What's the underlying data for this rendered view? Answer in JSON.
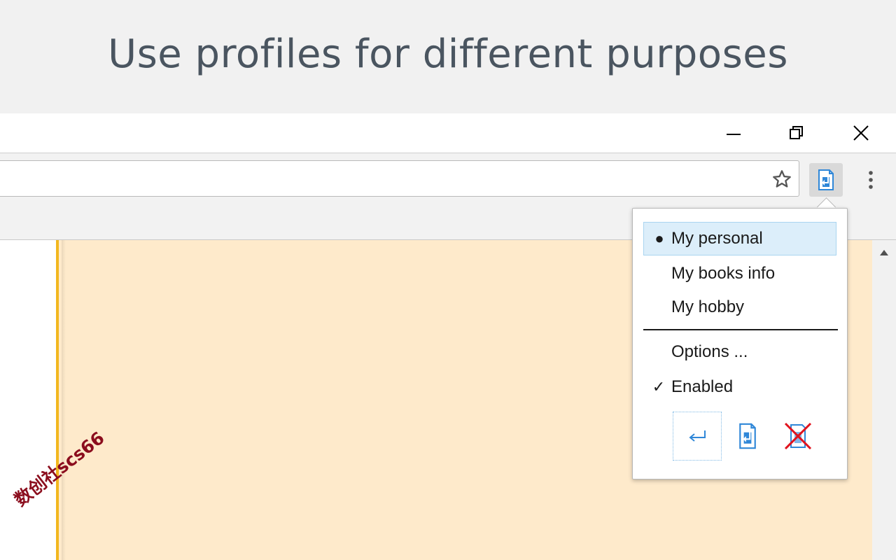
{
  "headline": "Use profiles for different purposes",
  "window": {
    "minimize_icon": "minimize-icon",
    "maximize_icon": "restore-icon",
    "close_icon": "close-icon"
  },
  "toolbar": {
    "bookmark_icon": "star-icon",
    "extension_icon": "profile-switch-icon",
    "menu_icon": "kebab-menu-icon"
  },
  "popup": {
    "profiles": [
      {
        "label": "My personal",
        "active": true
      },
      {
        "label": "My books info",
        "active": false
      },
      {
        "label": "My hobby",
        "active": false
      }
    ],
    "options_label": "Options ...",
    "enabled_label": "Enabled",
    "enabled_checked": true,
    "bottom_icons": [
      "return-arrow-icon",
      "profile-switch-icon",
      "disabled-profile-icon"
    ]
  },
  "watermark": "数创社scs66",
  "colors": {
    "page_background": "#feeacb",
    "page_border": "#f2b71e",
    "selected_item": "#dceefa",
    "icon_blue": "#2f87d8",
    "disabled_red": "#e0121d"
  }
}
